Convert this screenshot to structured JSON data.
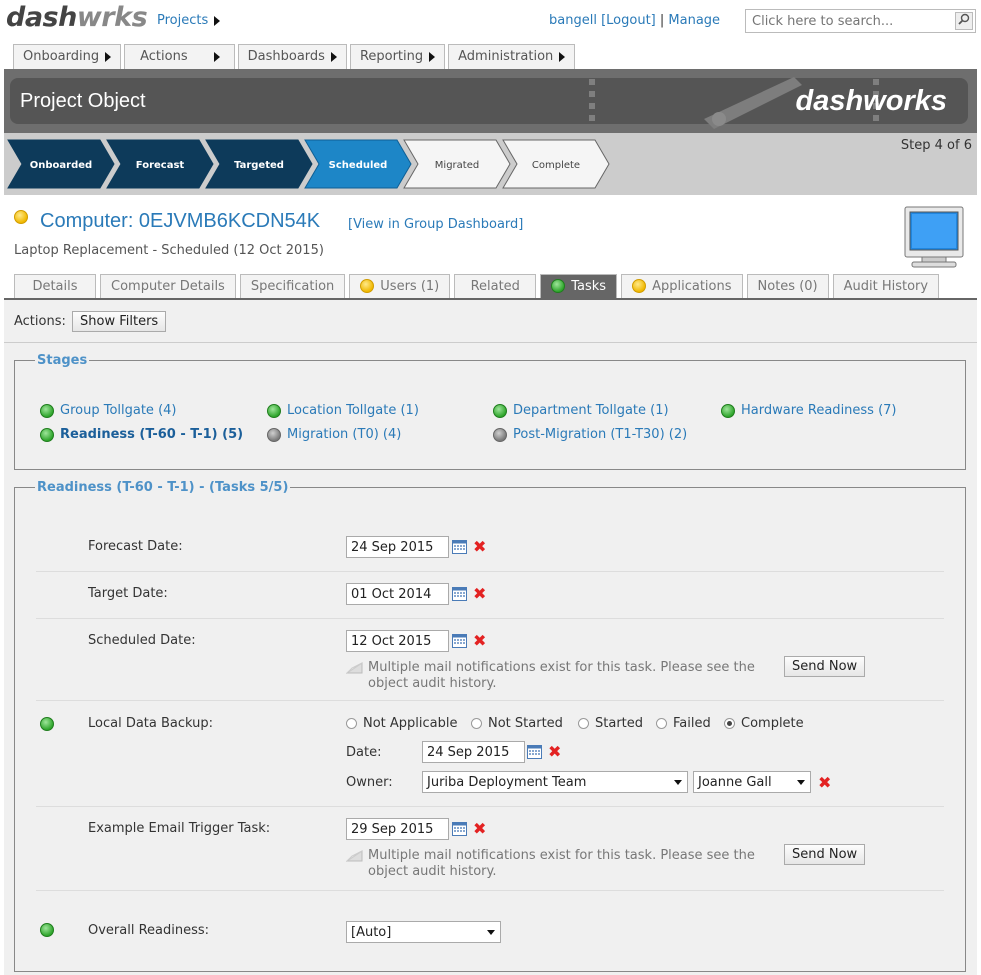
{
  "app": {
    "logo_a": "dash",
    "logo_o": "w",
    "logo_b": "rks",
    "projects_label": "Projects"
  },
  "user": {
    "name": "bangell",
    "logout": "[Logout]",
    "separator": "|",
    "manage": "Manage"
  },
  "search": {
    "placeholder": "Click here to search..."
  },
  "nav": [
    {
      "label": "Onboarding"
    },
    {
      "label": "Actions"
    },
    {
      "label": "Dashboards"
    },
    {
      "label": "Reporting"
    },
    {
      "label": "Administration"
    }
  ],
  "banner": {
    "title": "Project Object",
    "brand": "dashworks"
  },
  "steps": {
    "items": [
      "Onboarded",
      "Forecast",
      "Targeted",
      "Scheduled",
      "Migrated",
      "Complete"
    ],
    "current_index": 3,
    "info": "Step 4 of 6"
  },
  "object": {
    "title": "Computer: 0EJVMB6KCDN54K",
    "group_link": "[View in Group Dashboard]",
    "subtitle": "Laptop Replacement - Scheduled (12 Oct 2015)",
    "status": "yellow"
  },
  "tabs": [
    {
      "label": "Details",
      "icon": null
    },
    {
      "label": "Computer Details",
      "icon": null
    },
    {
      "label": "Specification",
      "icon": null
    },
    {
      "label": "Users (1)",
      "icon": "yellow"
    },
    {
      "label": "Related",
      "icon": null
    },
    {
      "label": "Tasks",
      "icon": "green",
      "active": true
    },
    {
      "label": "Applications",
      "icon": "yellow"
    },
    {
      "label": "Notes (0)",
      "icon": null
    },
    {
      "label": "Audit History",
      "icon": null
    }
  ],
  "actions": {
    "label": "Actions:",
    "show_filters": "Show Filters"
  },
  "stages": {
    "legend": "Stages",
    "items": [
      {
        "label": "Group Tollgate (4)",
        "status": "green"
      },
      {
        "label": "Location Tollgate (1)",
        "status": "green"
      },
      {
        "label": "Department Tollgate (1)",
        "status": "green"
      },
      {
        "label": "Hardware Readiness (7)",
        "status": "green"
      },
      {
        "label": "Readiness (T-60 - T-1) (5)",
        "status": "green",
        "selected": true
      },
      {
        "label": "Migration (T0) (4)",
        "status": "gray"
      },
      {
        "label": "Post-Migration (T1-T30) (2)",
        "status": "gray"
      }
    ]
  },
  "readiness": {
    "legend": "Readiness (T-60 - T-1) - (Tasks 5/5)",
    "forecast": {
      "label": "Forecast Date:",
      "value": "24 Sep 2015"
    },
    "target": {
      "label": "Target Date:",
      "value": "01 Oct 2014"
    },
    "scheduled": {
      "label": "Scheduled Date:",
      "value": "12 Oct 2015",
      "note1": "Multiple mail notifications exist for this task. Please see the",
      "note2": "object audit history.",
      "send": "Send Now"
    },
    "backup": {
      "label": "Local Data Backup:",
      "status": "green",
      "options": [
        "Not Applicable",
        "Not Started",
        "Started",
        "Failed",
        "Complete"
      ],
      "selected": "Complete",
      "date_label": "Date:",
      "date_value": "24 Sep 2015",
      "owner_label": "Owner:",
      "owner_team": "Juriba Deployment Team",
      "owner_person": "Joanne Gall"
    },
    "email_task": {
      "label": "Example Email Trigger Task:",
      "value": "29 Sep 2015",
      "note1": "Multiple mail notifications exist for this task. Please see the",
      "note2": "object audit history.",
      "send": "Send Now"
    },
    "overall": {
      "label": "Overall Readiness:",
      "value": "[Auto]",
      "status": "green"
    }
  }
}
